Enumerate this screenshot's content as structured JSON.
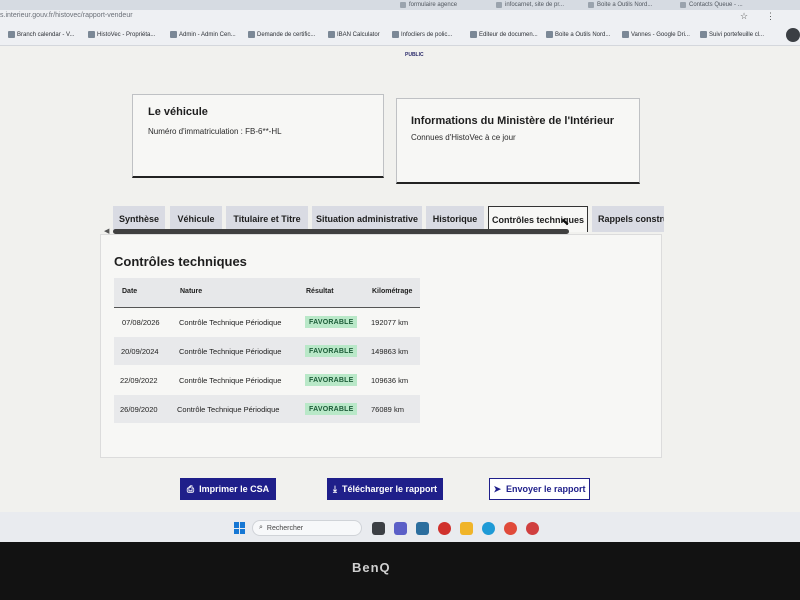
{
  "browser": {
    "tabs": [
      "formulaire agence",
      "infocarnet, site de pr...",
      "Boite a Outils Nord...",
      "Contacts Queue - ..."
    ],
    "url": "s.interieur.gouv.fr/histovec/rapport-vendeur",
    "bookmarks": [
      "Branch calendar - V...",
      "HistoVec - Propriéta...",
      "Admin - Admin Cen...",
      "Demande de certific...",
      "IBAN Calculator",
      "Infocliers de polic...",
      "Editeur de documen...",
      "Boite a Outils Nord...",
      "Vannes - Google Dri...",
      "Suivi portefeuille cl..."
    ]
  },
  "header": {
    "logo_text": "PUBLIC"
  },
  "vehicle_card": {
    "title": "Le véhicule",
    "plate_label": "Numéro d'immatriculation : FB-6**-HL"
  },
  "ministry_card": {
    "title": "Informations du Ministère de l'Intérieur",
    "subtitle": "Connues d'HistoVec à ce jour"
  },
  "tabs": [
    "Synthèse",
    "Véhicule",
    "Titulaire et Titre",
    "Situation administrative",
    "Historique",
    "Contrôles techniques",
    "Rappels constructeur"
  ],
  "section_title": "Contrôles techniques",
  "table": {
    "headers": [
      "Date",
      "Nature",
      "Résultat",
      "Kilométrage"
    ],
    "rows": [
      [
        "07/08/2026",
        "Contrôle Technique Périodique",
        "FAVORABLE",
        "192077 km"
      ],
      [
        "20/09/2024",
        "Contrôle Technique Périodique",
        "FAVORABLE",
        "149863 km"
      ],
      [
        "22/09/2022",
        "Contrôle Technique Périodique",
        "FAVORABLE",
        "109636 km"
      ],
      [
        "26/09/2020",
        "Contrôle Technique Périodique",
        "FAVORABLE",
        "76089 km"
      ]
    ]
  },
  "actions": {
    "print": "Imprimer le CSA",
    "download": "Télécharger le rapport",
    "send": "Envoyer le rapport"
  },
  "taskbar": {
    "search_placeholder": "Rechercher"
  },
  "monitor_brand": "BenQ",
  "colors": {
    "primary": "#1f1f8a",
    "badge_bg": "#b9e8c8",
    "badge_text": "#1c5c38"
  }
}
